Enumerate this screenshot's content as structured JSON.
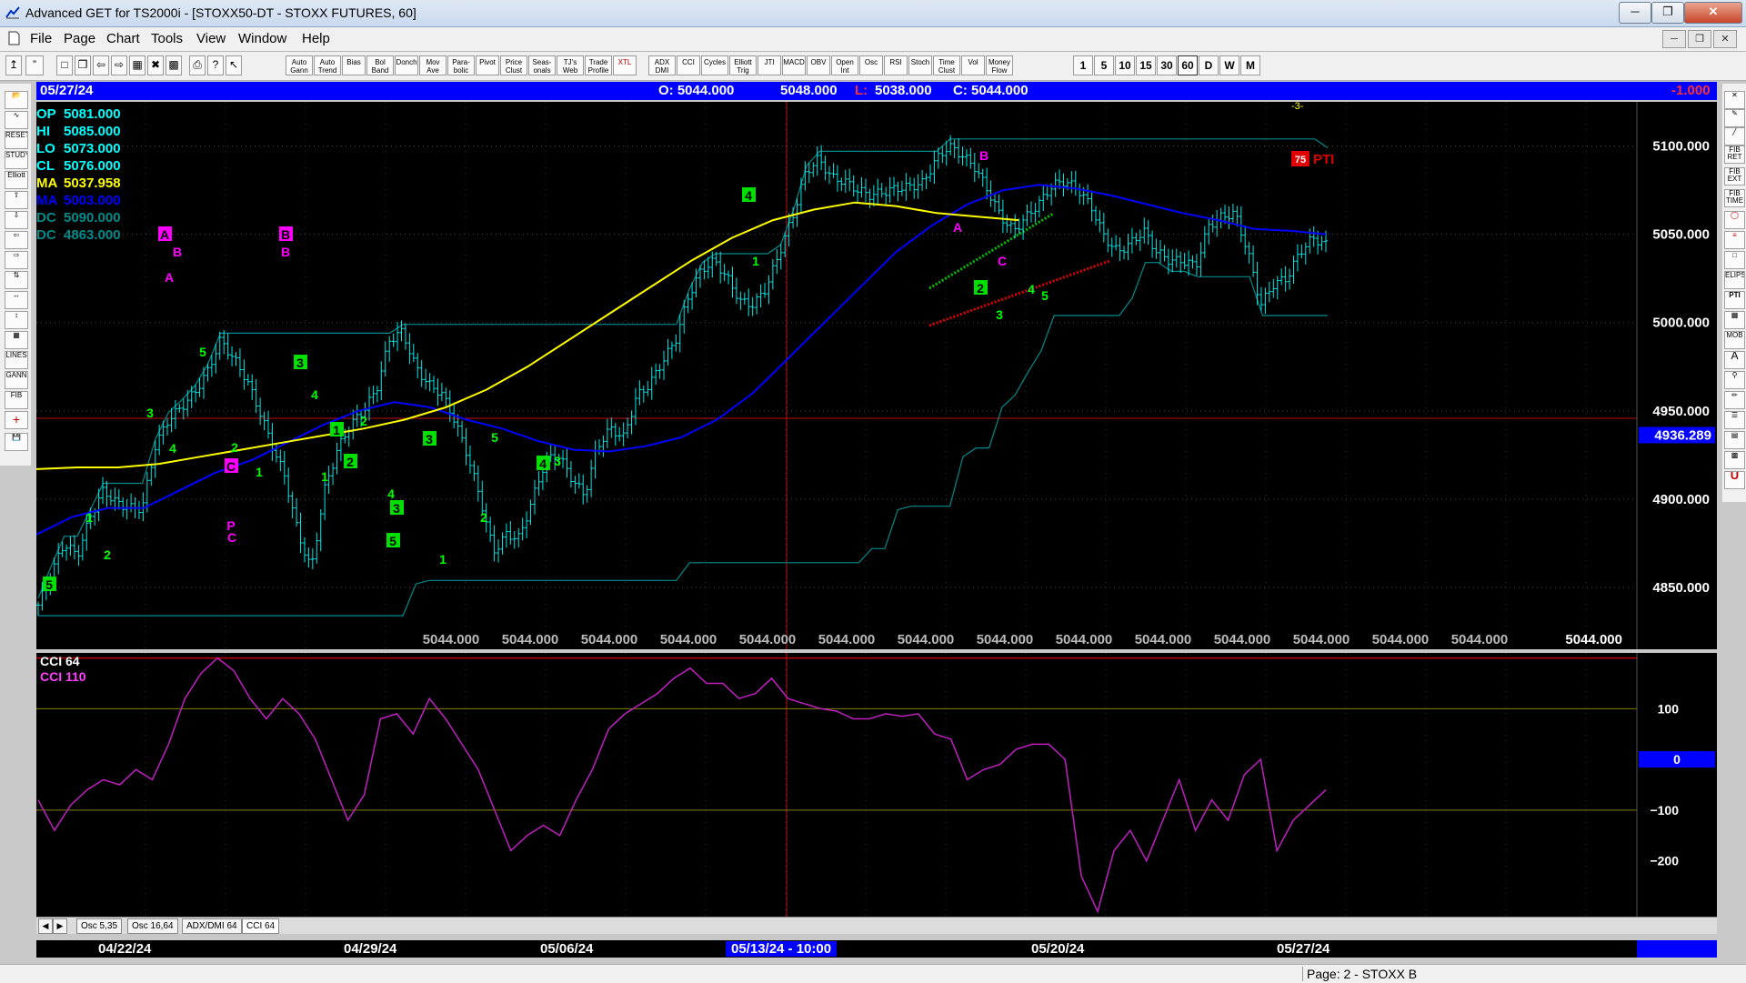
{
  "window": {
    "title": "Advanced GET for TS2000i - [STOXX50-DT - STOXX FUTURES, 60]",
    "min": "─",
    "max": "❐",
    "close": "✕"
  },
  "menu": [
    "File",
    "Page",
    "Chart",
    "Tools",
    "View",
    "Window",
    "Help"
  ],
  "toolbar": {
    "studies": [
      "Auto Gann",
      "Auto Trend",
      "Bias",
      "Bol Band",
      "Donch",
      "Mov Ave",
      "Para-bolic",
      "Pivot",
      "Price Clust",
      "Seas-onals",
      "TJ's Web",
      "Trade Profile",
      "XTL",
      "ADX DMI",
      "CCI",
      "Cycles",
      "Elliott Trig",
      "JTI",
      "MACD",
      "OBV",
      "Open Int",
      "Osc",
      "RSI",
      "Stoch",
      "Time Clust",
      "Vol",
      "Money Flow"
    ],
    "timeframes": [
      "1",
      "5",
      "10",
      "15",
      "30",
      "60",
      "D",
      "W",
      "M"
    ]
  },
  "left_tools": [
    "RESET",
    "STUDY",
    "Elliott",
    "LINES",
    "GANN",
    "FIB"
  ],
  "right_tools": [
    "FIB RET",
    "FIB EXT",
    "FIB TIME",
    "ELIPS",
    "PTI",
    "MOB",
    "A",
    "U"
  ],
  "infobar": {
    "date": "05/27/24",
    "open": "O: 5044.000",
    "high": "5048.000",
    "low_label": "L:",
    "low": "5038.000",
    "close": "C: 5044.000",
    "change": "-1.000"
  },
  "legend": [
    {
      "label": "OP",
      "value": "5081.000",
      "color": "#00ffff"
    },
    {
      "label": "HI",
      "value": "5085.000",
      "color": "#00ffff"
    },
    {
      "label": "LO",
      "value": "5073.000",
      "color": "#00ffff"
    },
    {
      "label": "CL",
      "value": "5076.000",
      "color": "#00ffff"
    },
    {
      "label": "MA",
      "value": "5037.958",
      "color": "#ffff00"
    },
    {
      "label": "MA",
      "value": "5003.000",
      "color": "#0000ff"
    },
    {
      "label": "DC",
      "value": "5090.000",
      "color": "#008b8b"
    },
    {
      "label": "DC",
      "value": "4863.000",
      "color": "#008b8b"
    }
  ],
  "price_axis": [
    "5100.000",
    "5050.000",
    "5000.000",
    "4950.000",
    "4900.000",
    "4850.000"
  ],
  "crosshair_price": "4936.289",
  "bottom_prices": [
    "5044.000",
    "5044.000",
    "5044.000",
    "5044.000",
    "5044.000",
    "5044.000",
    "5044.000",
    "5044.000",
    "5044.000",
    "5044.000",
    "5044.000",
    "5044.000",
    "5044.000",
    "5044.000",
    "5044.000"
  ],
  "pti": {
    "value": "75",
    "label": "PTI"
  },
  "top_marker": "-3-",
  "cci": {
    "title": "CCI 64",
    "sub_label": "CCI  110",
    "axis": [
      "100",
      "0",
      "−100",
      "−200"
    ],
    "zero_marker": "0"
  },
  "tabs": [
    "Osc 5,35",
    "Osc 16,64",
    "ADX/DMI 64",
    "CCI 64"
  ],
  "dates": [
    "04/22/24",
    "04/29/24",
    "05/06/24",
    "05/13/24 - 10:00",
    "05/20/24",
    "05/27/24"
  ],
  "status": "Page: 2 - STOXX B",
  "colors": {
    "background": "#000000",
    "bar": "#00ffff",
    "ma_fast": "#0000ff",
    "ma_slow": "#ffff00",
    "donchian": "#008b8b",
    "cci": "#c020c0",
    "green_label": "#00ff00",
    "magenta_label": "#ff00ff",
    "info_bar": "#0000ff"
  },
  "chart_data": {
    "type": "line",
    "price_range": [
      4815,
      5125
    ],
    "crosshair_price": 4936.289,
    "close_path": [
      4840,
      4858,
      4875,
      4868,
      4890,
      4905,
      4898,
      4895,
      4895,
      4930,
      4945,
      4952,
      4960,
      4972,
      4990,
      4980,
      4968,
      4950,
      4930,
      4912,
      4880,
      4860,
      4905,
      4928,
      4942,
      4950,
      4962,
      4990,
      4995,
      4975,
      4965,
      4960,
      4945,
      4925,
      4900,
      4870,
      4880,
      4878,
      4900,
      4922,
      4925,
      4912,
      4902,
      4930,
      4940,
      4935,
      4958,
      4965,
      4978,
      4990,
      5015,
      5030,
      5035,
      5025,
      5012,
      5010,
      5020,
      5040,
      5060,
      5085,
      5093,
      5082,
      5080,
      5075,
      5072,
      5074,
      5076,
      5077,
      5079,
      5092,
      5100,
      5095,
      5088,
      5075,
      5060,
      5052,
      5060,
      5068,
      5078,
      5080,
      5075,
      5065,
      5048,
      5040,
      5045,
      5052,
      5040,
      5035,
      5035,
      5032,
      5055,
      5060,
      5062,
      5040,
      5010,
      5022,
      5025,
      5040,
      5048,
      5044
    ],
    "ma_fast_path": [
      4880,
      4890,
      4895,
      4895,
      4905,
      4915,
      4922,
      4932,
      4942,
      4950,
      4955,
      4952,
      4945,
      4940,
      4933,
      4928,
      4927,
      4930,
      4935,
      4945,
      4960,
      4980,
      5000,
      5020,
      5040,
      5055,
      5067,
      5075,
      5078,
      5076,
      5072,
      5067,
      5062,
      5058,
      5053,
      5052,
      5050
    ],
    "ma_slow_path": [
      4917,
      4918,
      4918,
      4920,
      4924,
      4928,
      4932,
      4936,
      4940,
      4945,
      4952,
      4962,
      4975,
      4990,
      5005,
      5020,
      5035,
      5048,
      5058,
      5064,
      5068,
      5066,
      5062,
      5060,
      5058
    ],
    "cci_range": [
      -310,
      210
    ],
    "cci_levels": [
      200,
      100,
      -100
    ],
    "cci_path": [
      -80,
      -140,
      -90,
      -60,
      -40,
      -50,
      -20,
      -40,
      30,
      120,
      170,
      200,
      175,
      120,
      80,
      120,
      90,
      40,
      -40,
      -120,
      -70,
      80,
      90,
      50,
      120,
      80,
      30,
      -20,
      -100,
      -180,
      -150,
      -130,
      -150,
      -80,
      -20,
      60,
      90,
      110,
      130,
      160,
      180,
      150,
      150,
      120,
      130,
      160,
      120,
      110,
      100,
      95,
      80,
      80,
      90,
      85,
      90,
      50,
      40,
      -40,
      -20,
      -10,
      20,
      30,
      30,
      0,
      -230,
      -300,
      -180,
      -140,
      -200,
      -120,
      -40,
      -140,
      -80,
      -120,
      -30,
      0,
      -180,
      -120,
      -90,
      -60
    ],
    "wave_labels_green": [
      "5",
      "1",
      "2",
      "3",
      "4",
      "5",
      "1",
      "2",
      "3",
      "4",
      "1",
      "2",
      "1",
      "2",
      "3",
      "4",
      "5",
      "1",
      "2",
      "3",
      "4",
      "5",
      "3",
      "4",
      "1",
      "2",
      "3",
      "4",
      "5"
    ],
    "wave_labels_magenta": [
      "A",
      "B",
      "A",
      "C",
      "B",
      "C",
      "P",
      "B",
      "A",
      "B",
      "C"
    ]
  }
}
